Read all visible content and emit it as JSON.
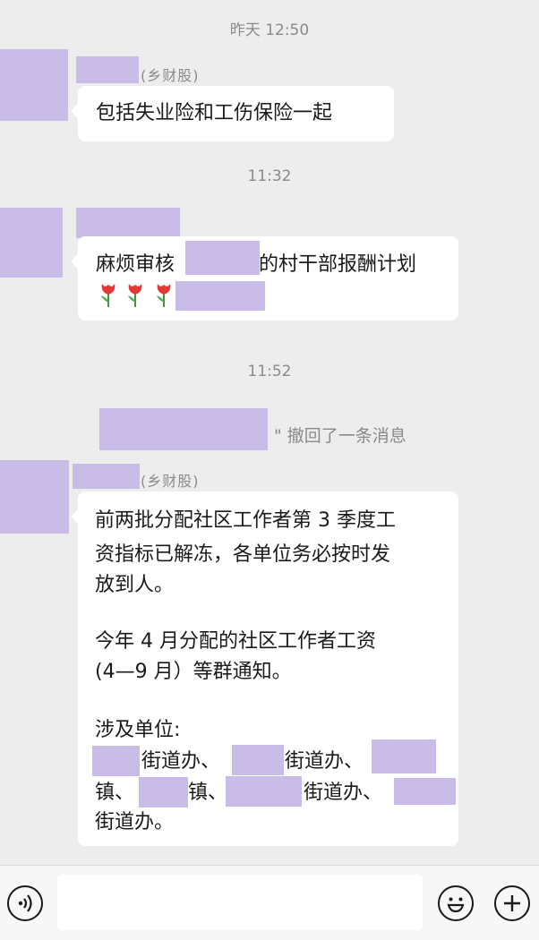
{
  "timestamps": [
    "昨天 12:50",
    "11:32",
    "11:52"
  ],
  "sender_tag": "(乡财股)",
  "messages": {
    "m1": {
      "text": "包括失业险和工伤保险一起"
    },
    "m2": {
      "line1_a": "麻烦审核",
      "line1_b": "的村干部报酬计划"
    },
    "recall": {
      "text": "\" 撤回了一条消息"
    },
    "m3": {
      "line1": "前两批分配社区工作者第 3 季度工",
      "line2": "资指标已解冻，各单位务必按时发",
      "line3": "放到人。",
      "line4": "今年 4 月分配的社区工作者工资",
      "line5": "(4—9 月）等群通知。",
      "line6": "涉及单位:",
      "line7_a": "街道办、",
      "line7_b": "街道办、",
      "line8_a": "镇、",
      "line8_b": "镇、",
      "line8_c": "街道办、",
      "line9": "街道办。"
    }
  },
  "icons": {
    "voice": "voice-icon",
    "emoji": "emoji-icon",
    "plus": "plus-icon",
    "tulip": "tulip-emoji"
  },
  "colors": {
    "background": "#ededed",
    "bubble": "#ffffff",
    "redaction": "#c9bde8",
    "muted_text": "#8a8a8a"
  }
}
